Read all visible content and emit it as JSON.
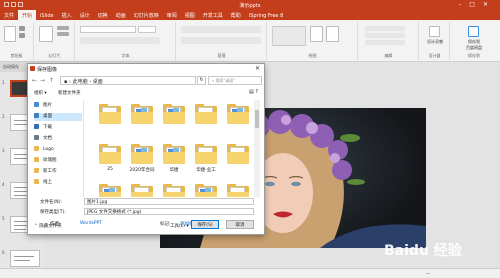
{
  "window": {
    "title": "演示pptx"
  },
  "ribbon_tabs": [
    "文件",
    "开始",
    "iSlide",
    "插入",
    "设计",
    "切换",
    "动画",
    "幻灯片放映",
    "审阅",
    "视图",
    "开发工具",
    "帮助",
    "iSpring Free 8"
  ],
  "active_tab": "开始",
  "ribbon_groups": [
    "剪贴板",
    "幻灯片",
    "字体",
    "段落",
    "绘图",
    "编辑",
    "设计器",
    "保存到"
  ],
  "ribbon_right": {
    "designer_label": "设计灵感",
    "save_label": "保存到\n百度网盘"
  },
  "left_panel_label": "自动保存",
  "slide_numbers": [
    "1",
    "2",
    "3",
    "4",
    "5",
    "6"
  ],
  "dialog": {
    "title": "保存图像",
    "breadcrumb": [
      "此电脑",
      "桌面"
    ],
    "search_placeholder": "搜索\"桌面\"",
    "organize": "组织 ▾",
    "new_folder": "新建文件夹",
    "nav_items": [
      {
        "label": "图片",
        "icon": "pictures-icon",
        "color": "#4a8bd6"
      },
      {
        "label": "桌面",
        "icon": "desktop-icon",
        "color": "#3d7fc4"
      },
      {
        "label": "下载",
        "icon": "download-icon",
        "color": "#2f6db5"
      },
      {
        "label": "文档",
        "icon": "document-icon",
        "color": "#6d7a88"
      },
      {
        "label": "Logo",
        "icon": "folder-icon",
        "color": "#e8b84a"
      },
      {
        "label": "玫瑰图",
        "icon": "folder-icon",
        "color": "#e8b84a"
      },
      {
        "label": "新工作",
        "icon": "folder-icon",
        "color": "#e8b84a"
      },
      {
        "label": "线上",
        "icon": "folder-icon",
        "color": "#e8b84a"
      }
    ],
    "files": [
      {
        "name": "",
        "style": "plain"
      },
      {
        "name": "",
        "style": "doc"
      },
      {
        "name": "",
        "style": "doc"
      },
      {
        "name": "",
        "style": "plain"
      },
      {
        "name": "",
        "style": "doc"
      },
      {
        "name": "25",
        "style": "plain"
      },
      {
        "name": "2020年合同",
        "style": "doc"
      },
      {
        "name": "华捷",
        "style": "doc"
      },
      {
        "name": "华捷-业工",
        "style": "plain"
      },
      {
        "name": "",
        "style": "plain"
      },
      {
        "name": "",
        "style": "doc"
      },
      {
        "name": "",
        "style": "plain"
      },
      {
        "name": "",
        "style": "plain"
      },
      {
        "name": "",
        "style": "doc"
      },
      {
        "name": "",
        "style": "plain"
      }
    ],
    "filename_label": "文件名(N):",
    "filename_value": "图片1.jpg",
    "filetype_label": "保存类型(T):",
    "filetype_value": "JPEG 文件交换格式 (*.jpg)",
    "author_label": "作者:",
    "author_value": "WordsPPT",
    "tags_label": "标记:",
    "tags_value": "添加标记",
    "hide_folders": "⌃ 隐藏文件夹",
    "tools": "工具(L)",
    "save": "保存(S)",
    "cancel": "取消"
  },
  "status": {
    "zoom": "—"
  },
  "watermark": "Baidu 经验"
}
